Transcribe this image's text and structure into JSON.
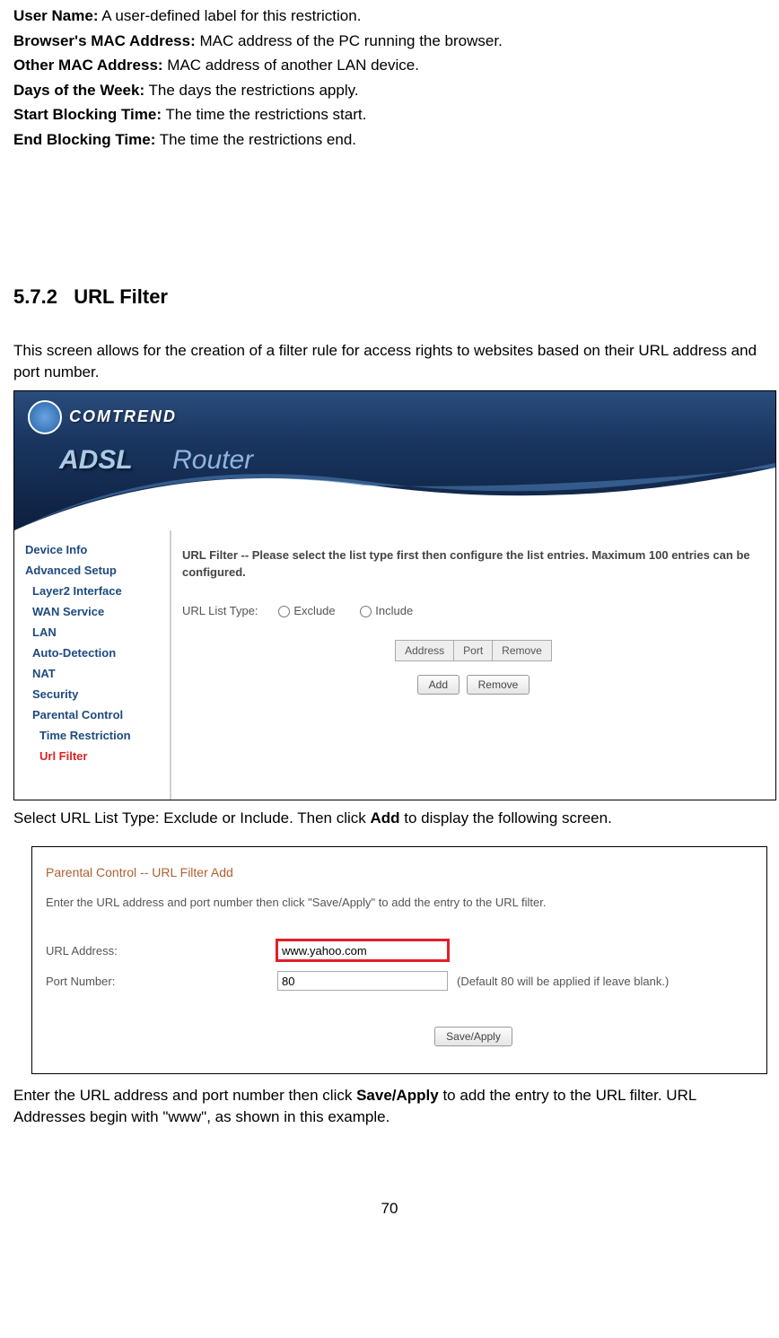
{
  "definitions": [
    {
      "label": "User Name:",
      "text": " A user-defined label for this restriction."
    },
    {
      "label": "Browser's MAC Address:",
      "text": " MAC address of the PC running the browser."
    },
    {
      "label": "Other MAC Address:",
      "text": " MAC address of another LAN device."
    },
    {
      "label": "Days of the Week:",
      "text": " The days the restrictions apply."
    },
    {
      "label": "Start Blocking Time:",
      "text": " The time the restrictions start."
    },
    {
      "label": "End Blocking Time:",
      "text": " The time the restrictions end."
    }
  ],
  "section": {
    "number": "5.7.2",
    "title": "URL Filter"
  },
  "intro_text": "This screen allows for the creation of a filter rule for access rights to websites based on their URL address and port number.",
  "router": {
    "brand": "COMTREND",
    "product": "ADSL",
    "sub": "Router",
    "panel_heading": "URL Filter -- Please select the list type first then configure the list entries. Maximum 100 entries can be configured.",
    "list_type_label": "URL List Type:",
    "radio_exclude": "Exclude",
    "radio_include": "Include",
    "nav": [
      {
        "label": "Device Info",
        "cls": ""
      },
      {
        "label": "Advanced Setup",
        "cls": ""
      },
      {
        "label": "Layer2 Interface",
        "cls": "nav-child"
      },
      {
        "label": "WAN Service",
        "cls": "nav-child"
      },
      {
        "label": "LAN",
        "cls": "nav-child"
      },
      {
        "label": "Auto-Detection",
        "cls": "nav-child"
      },
      {
        "label": "NAT",
        "cls": "nav-child"
      },
      {
        "label": "Security",
        "cls": "nav-child"
      },
      {
        "label": "Parental Control",
        "cls": "nav-child"
      },
      {
        "label": "Time Restriction",
        "cls": "nav-grandchild"
      },
      {
        "label": "Url Filter",
        "cls": "nav-grandchild nav-active"
      }
    ],
    "table_headers": [
      "Address",
      "Port",
      "Remove"
    ],
    "btn_add": "Add",
    "btn_remove": "Remove"
  },
  "after_s1_pre": "Select URL List Type: Exclude or Include. Then click ",
  "after_s1_bold": "Add",
  "after_s1_post": " to display the following screen.",
  "urlfilter": {
    "title": "Parental Control -- URL Filter Add",
    "instr": "Enter the URL address and port number then click \"Save/Apply\" to add the entry to the URL filter.",
    "url_label": "URL Address:",
    "url_value": "www.yahoo.com",
    "port_label": "Port Number:",
    "port_value": "80",
    "port_hint": "(Default 80 will be applied if leave blank.)",
    "save_btn": "Save/Apply"
  },
  "after_s2_pre": "Enter the URL address and port number then click ",
  "after_s2_bold": "Save/Apply",
  "after_s2_post": " to add the entry to the URL filter.   URL Addresses begin with \"www\", as shown in this example.",
  "page_number": "70"
}
